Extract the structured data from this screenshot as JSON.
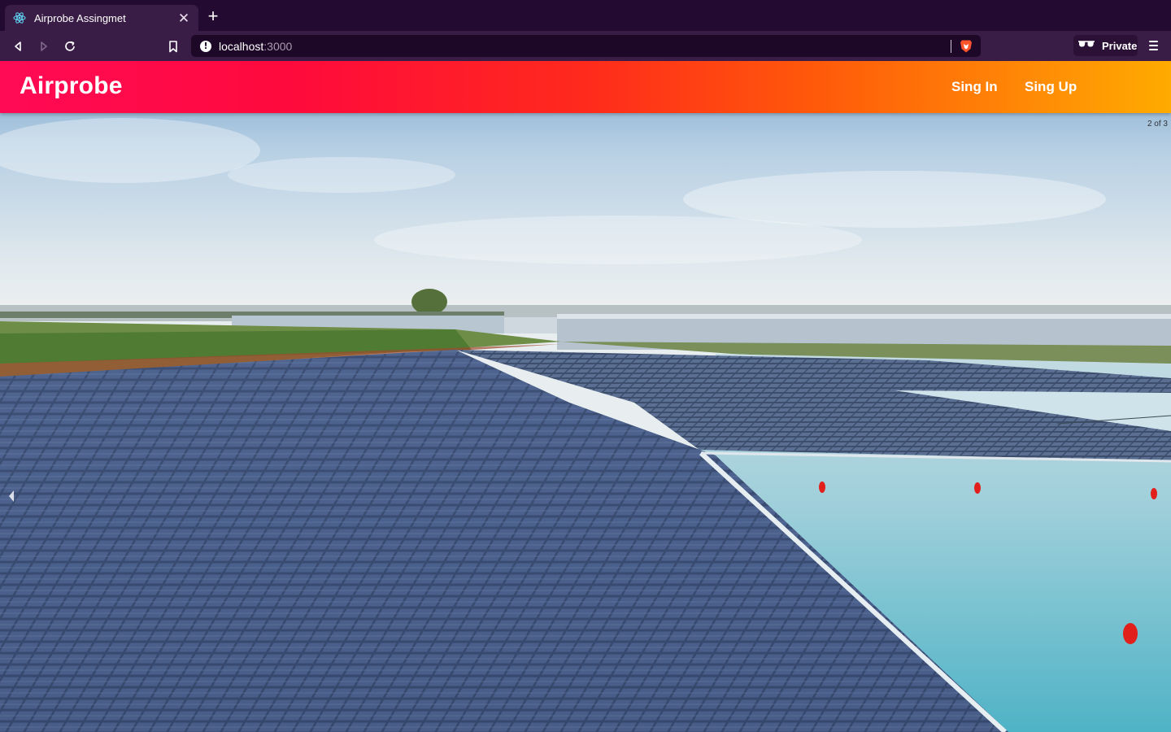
{
  "browser": {
    "tab": {
      "title": "Airprobe Assingmet",
      "favicon": "react-icon",
      "close_icon": "close-icon"
    },
    "new_tab_icon": "plus-icon",
    "toolbar": {
      "back_icon": "back-arrow-icon",
      "forward_icon": "forward-arrow-icon",
      "reload_icon": "reload-icon",
      "bookmark_icon": "bookmark-icon",
      "url_host": "localhost",
      "url_port": ":3000",
      "site_info_icon": "info-icon",
      "shield_icon": "brave-lion-icon",
      "private_label": "Private",
      "private_icon": "incognito-glasses-icon",
      "menu_icon": "hamburger-menu-icon"
    },
    "colors": {
      "tabstrip": "#230a30",
      "toolbar": "#3a1d47",
      "urlbar": "#1e0828"
    }
  },
  "appbar": {
    "brand": "Airprobe",
    "links": [
      "Sing In",
      "Sing Up"
    ],
    "gradient": [
      "#ff0a55",
      "#ff2a1c",
      "#ff8a06",
      "#ffab00"
    ]
  },
  "carousel": {
    "counter": "2 of 3",
    "prev_icon": "chevron-left-icon",
    "image": "floating-solar-panels-on-lake"
  }
}
